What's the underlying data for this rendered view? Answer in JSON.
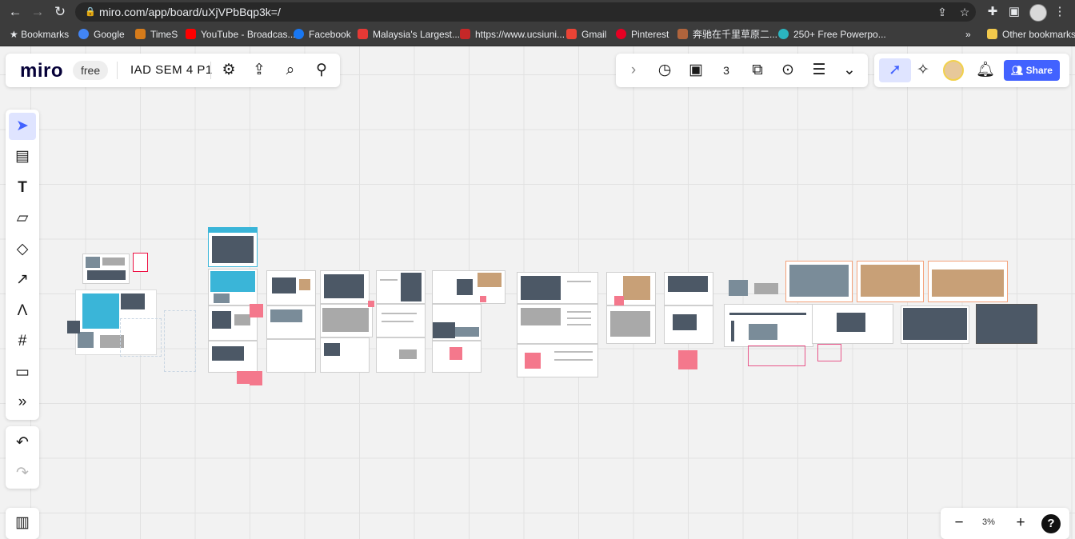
{
  "browser": {
    "url": "miro.com/app/board/uXjVPbBqp3k=/",
    "bookmarks": [
      {
        "label": "Bookmarks",
        "color": "#e8eaed",
        "icon": "star-icon"
      },
      {
        "label": "Google",
        "color": "#4285f4",
        "icon": "google-icon"
      },
      {
        "label": "TimeS",
        "color": "#d67b1a",
        "icon": "times-icon"
      },
      {
        "label": "YouTube - Broadcas...",
        "color": "#ff0000",
        "icon": "youtube-icon"
      },
      {
        "label": "Facebook",
        "color": "#1877f2",
        "icon": "facebook-icon"
      },
      {
        "label": "Malaysia's Largest...",
        "color": "#e53935",
        "icon": "mudah-icon"
      },
      {
        "label": "https://www.ucsiuni...",
        "color": "#c62828",
        "icon": "ucsi-icon"
      },
      {
        "label": "Gmail",
        "color": "#ea4335",
        "icon": "gmail-icon"
      },
      {
        "label": "Pinterest",
        "color": "#e60023",
        "icon": "pinterest-icon"
      },
      {
        "label": "奔驰在千里草原二...",
        "color": "#b0643c",
        "icon": "site-icon"
      },
      {
        "label": "250+ Free Powerpo...",
        "color": "#2bb5c0",
        "icon": "slides-icon"
      }
    ],
    "overflow": "»",
    "other_bookmarks": "Other bookmarks"
  },
  "miro": {
    "logo": "miro",
    "plan_badge": "free",
    "board_name": "IAD SEM 4 P1",
    "share_label": "Share",
    "zoom_level": "3%",
    "help_label": "?",
    "counter_label": "3"
  },
  "colors": {
    "accent": "#4262ff",
    "sticky": "#f4788c",
    "frame_border": "#cfcfcf"
  }
}
